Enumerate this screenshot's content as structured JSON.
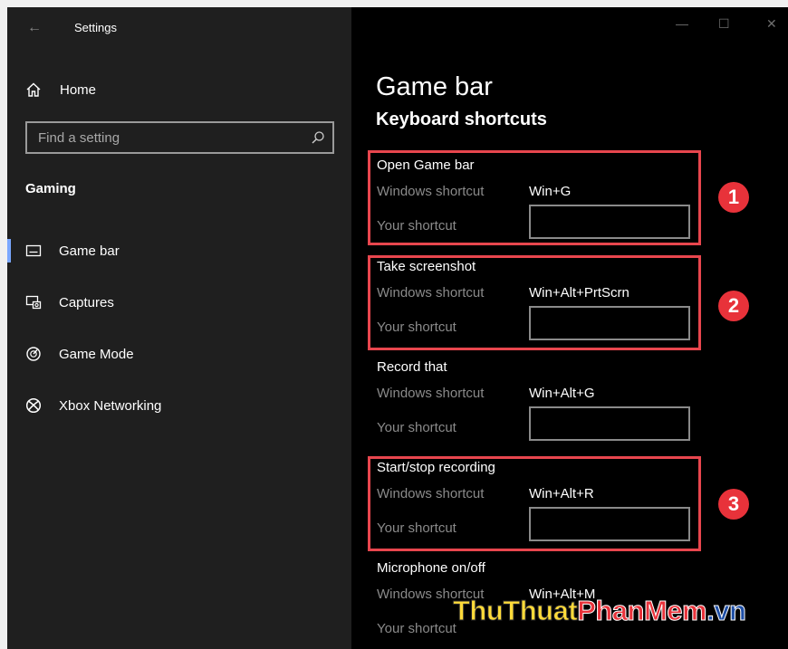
{
  "app": {
    "title": "Settings"
  },
  "sidebar": {
    "home_label": "Home",
    "search_placeholder": "Find a setting",
    "section_label": "Gaming",
    "items": [
      {
        "label": "Game bar",
        "icon": "game-bar-icon",
        "selected": true
      },
      {
        "label": "Captures",
        "icon": "captures-icon",
        "selected": false
      },
      {
        "label": "Game Mode",
        "icon": "game-mode-icon",
        "selected": false
      },
      {
        "label": "Xbox Networking",
        "icon": "xbox-icon",
        "selected": false
      }
    ]
  },
  "main": {
    "title": "Game bar",
    "subtitle": "Keyboard shortcuts",
    "windows_shortcut_label": "Windows shortcut",
    "your_shortcut_label": "Your shortcut",
    "shortcuts": [
      {
        "name": "Open Game bar",
        "windows": "Win+G",
        "your": ""
      },
      {
        "name": "Take screenshot",
        "windows": "Win+Alt+PrtScrn",
        "your": ""
      },
      {
        "name": "Record that",
        "windows": "Win+Alt+G",
        "your": ""
      },
      {
        "name": "Start/stop recording",
        "windows": "Win+Alt+R",
        "your": ""
      },
      {
        "name": "Microphone on/off",
        "windows": "Win+Alt+M",
        "your": ""
      }
    ]
  },
  "annotations": {
    "badges": [
      "1",
      "2",
      "3"
    ],
    "color": "#e8323a"
  },
  "watermark": {
    "part1": "ThuThuat",
    "part2": "PhanMem",
    "part3": ".vn"
  },
  "colors": {
    "sidebar_bg": "#1f1f1f",
    "content_bg": "#000000",
    "accent": "#7aa7ff",
    "highlight": "#e8464e"
  }
}
